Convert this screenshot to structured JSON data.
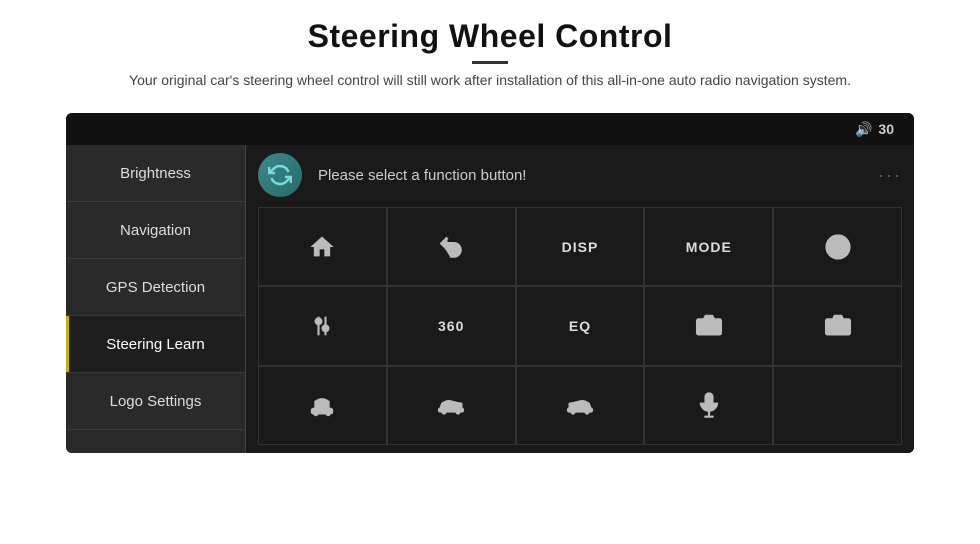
{
  "header": {
    "title": "Steering Wheel Control",
    "subtitle": "Your original car's steering wheel control will still work after installation of this all-in-one auto radio navigation system."
  },
  "topbar": {
    "volume_label": "30"
  },
  "sidebar": {
    "items": [
      {
        "label": "Brightness",
        "active": false
      },
      {
        "label": "Navigation",
        "active": false
      },
      {
        "label": "GPS Detection",
        "active": false
      },
      {
        "label": "Steering Learn",
        "active": true
      },
      {
        "label": "Logo Settings",
        "active": false
      }
    ]
  },
  "content": {
    "prompt": "Please select a function button!",
    "grid": [
      {
        "row": 0,
        "col": 0,
        "type": "home"
      },
      {
        "row": 0,
        "col": 1,
        "type": "back"
      },
      {
        "row": 0,
        "col": 2,
        "type": "disp",
        "label": "DISP"
      },
      {
        "row": 0,
        "col": 3,
        "type": "mode",
        "label": "MODE"
      },
      {
        "row": 0,
        "col": 4,
        "type": "phone"
      },
      {
        "row": 1,
        "col": 0,
        "type": "settings"
      },
      {
        "row": 1,
        "col": 1,
        "type": "360",
        "label": "360"
      },
      {
        "row": 1,
        "col": 2,
        "type": "eq",
        "label": "EQ"
      },
      {
        "row": 1,
        "col": 3,
        "type": "camera1"
      },
      {
        "row": 1,
        "col": 4,
        "type": "camera2"
      },
      {
        "row": 2,
        "col": 0,
        "type": "car"
      },
      {
        "row": 2,
        "col": 1,
        "type": "car2"
      },
      {
        "row": 2,
        "col": 2,
        "type": "car3"
      },
      {
        "row": 2,
        "col": 3,
        "type": "mic"
      },
      {
        "row": 2,
        "col": 4,
        "type": "empty"
      }
    ]
  }
}
